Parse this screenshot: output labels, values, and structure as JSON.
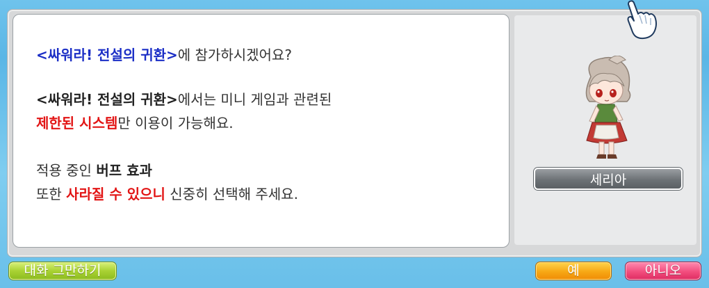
{
  "dialog": {
    "p1": {
      "event_name": "<싸워라! 전설의 귀환>",
      "rest": "에 참가하시겠어요?"
    },
    "p2": {
      "event_name": "<싸워라! 전설의 귀환>",
      "rest1": "에서는 미니 게임과 관련된",
      "restricted": "제한된 시스템",
      "rest2": "만 이용이 가능해요."
    },
    "p3": {
      "line1_a": "적용 중인 ",
      "buff": "버프 효과",
      "line2_a": "또한 ",
      "warning": "사라질 수 있으니",
      "line2_b": " 신중히 선택해 주세요."
    }
  },
  "npc": {
    "name": "세리아",
    "icon": "npc-portrait"
  },
  "buttons": {
    "end_chat": "대화 그만하기",
    "yes": "예",
    "no": "아니오"
  },
  "colors": {
    "event_name": "#1b2ec6",
    "highlight_red": "#e21414",
    "end_button": "#a9d233",
    "yes_button": "#f7a714",
    "no_button": "#f24d7d"
  }
}
